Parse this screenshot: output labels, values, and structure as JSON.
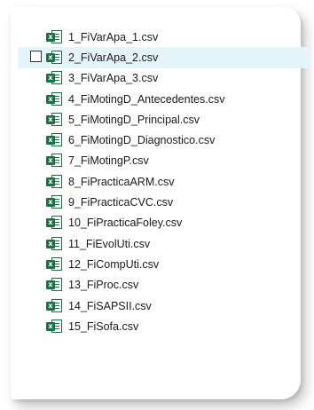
{
  "files": [
    {
      "name": "1_FiVarApa_1.csv",
      "icon": "excel-csv-icon",
      "selected": false
    },
    {
      "name": "2_FiVarApa_2.csv",
      "icon": "excel-csv-icon",
      "selected": true
    },
    {
      "name": "3_FiVarApa_3.csv",
      "icon": "excel-csv-icon",
      "selected": false
    },
    {
      "name": "4_FiMotingD_Antecedentes.csv",
      "icon": "excel-csv-icon",
      "selected": false
    },
    {
      "name": "5_FiMotingD_Principal.csv",
      "icon": "excel-csv-icon",
      "selected": false
    },
    {
      "name": "6_FiMotingD_Diagnostico.csv",
      "icon": "excel-csv-icon",
      "selected": false
    },
    {
      "name": "7_FiMotingP.csv",
      "icon": "excel-csv-icon",
      "selected": false
    },
    {
      "name": "8_FiPracticaARM.csv",
      "icon": "excel-csv-icon",
      "selected": false
    },
    {
      "name": "9_FiPracticaCVC.csv",
      "icon": "excel-csv-icon",
      "selected": false
    },
    {
      "name": "10_FiPracticaFoley.csv",
      "icon": "excel-csv-icon",
      "selected": false
    },
    {
      "name": "11_FiEvolUti.csv",
      "icon": "excel-csv-icon",
      "selected": false
    },
    {
      "name": "12_FiCompUti.csv",
      "icon": "excel-csv-icon",
      "selected": false
    },
    {
      "name": "13_FiProc.csv",
      "icon": "excel-csv-icon",
      "selected": false
    },
    {
      "name": "14_FiSAPSII.csv",
      "icon": "excel-csv-icon",
      "selected": false
    },
    {
      "name": "15_FiSofa.csv",
      "icon": "excel-csv-icon",
      "selected": false
    }
  ],
  "icon_badge_letter": "x",
  "colors": {
    "selection_background": "#e5f3fb",
    "excel_green": "#1d7044"
  }
}
